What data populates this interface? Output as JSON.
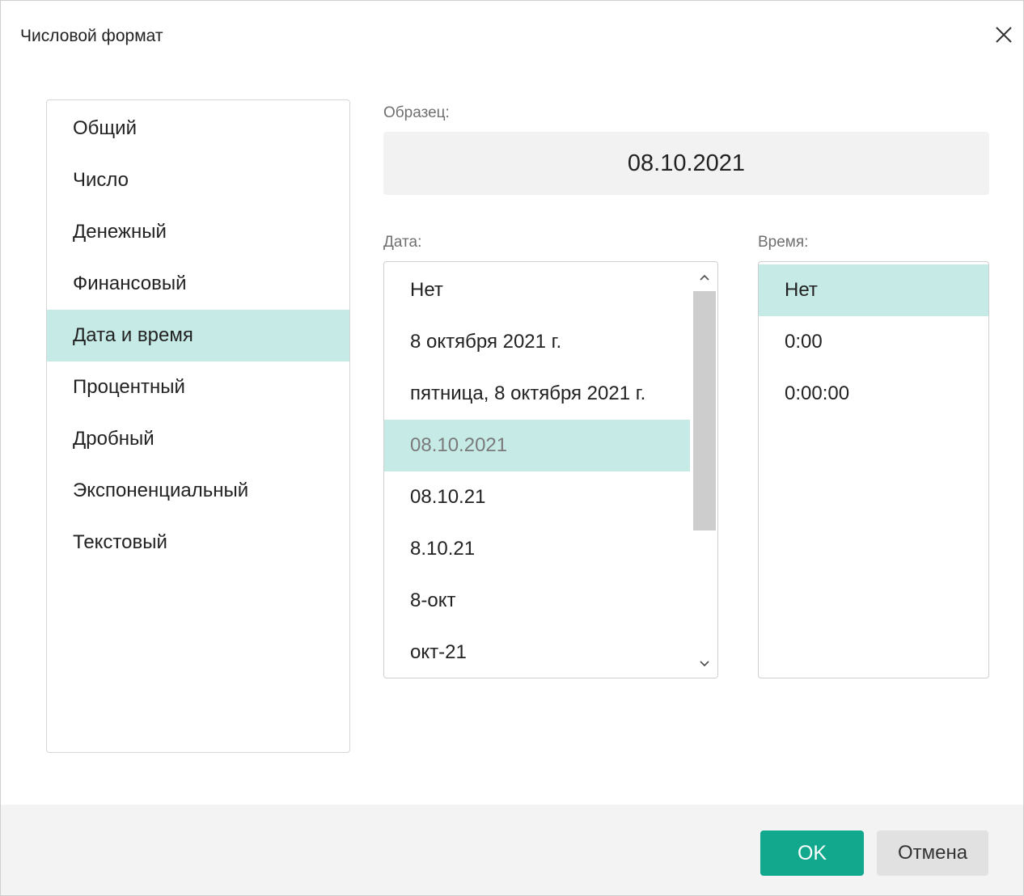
{
  "dialog": {
    "title": "Числовой формат",
    "close_icon": "close-icon"
  },
  "categories": [
    {
      "label": "Общий",
      "selected": false
    },
    {
      "label": "Число",
      "selected": false
    },
    {
      "label": "Денежный",
      "selected": false
    },
    {
      "label": "Финансовый",
      "selected": false
    },
    {
      "label": "Дата и время",
      "selected": true
    },
    {
      "label": "Процентный",
      "selected": false
    },
    {
      "label": "Дробный",
      "selected": false
    },
    {
      "label": "Экспоненциальный",
      "selected": false
    },
    {
      "label": "Текстовый",
      "selected": false
    }
  ],
  "sample": {
    "label": "Образец:",
    "value": "08.10.2021"
  },
  "date": {
    "label": "Дата:",
    "items": [
      {
        "label": "Нет",
        "selected": false
      },
      {
        "label": "8 октября 2021 г.",
        "selected": false
      },
      {
        "label": "пятница, 8 октября 2021 г.",
        "selected": false
      },
      {
        "label": "08.10.2021",
        "selected": true
      },
      {
        "label": "08.10.21",
        "selected": false
      },
      {
        "label": "8.10.21",
        "selected": false
      },
      {
        "label": "8-окт",
        "selected": false
      },
      {
        "label": "окт-21",
        "selected": false
      }
    ],
    "scroll_up_icon": "chevron-up-icon",
    "scroll_down_icon": "chevron-down-icon"
  },
  "time": {
    "label": "Время:",
    "items": [
      {
        "label": "Нет",
        "selected": true
      },
      {
        "label": "0:00",
        "selected": false
      },
      {
        "label": "0:00:00",
        "selected": false
      }
    ]
  },
  "footer": {
    "ok_label": "OK",
    "cancel_label": "Отмена"
  },
  "colors": {
    "accent": "#12a88e",
    "selection": "#c6ebe6",
    "footer_bg": "#f3f3f3"
  }
}
